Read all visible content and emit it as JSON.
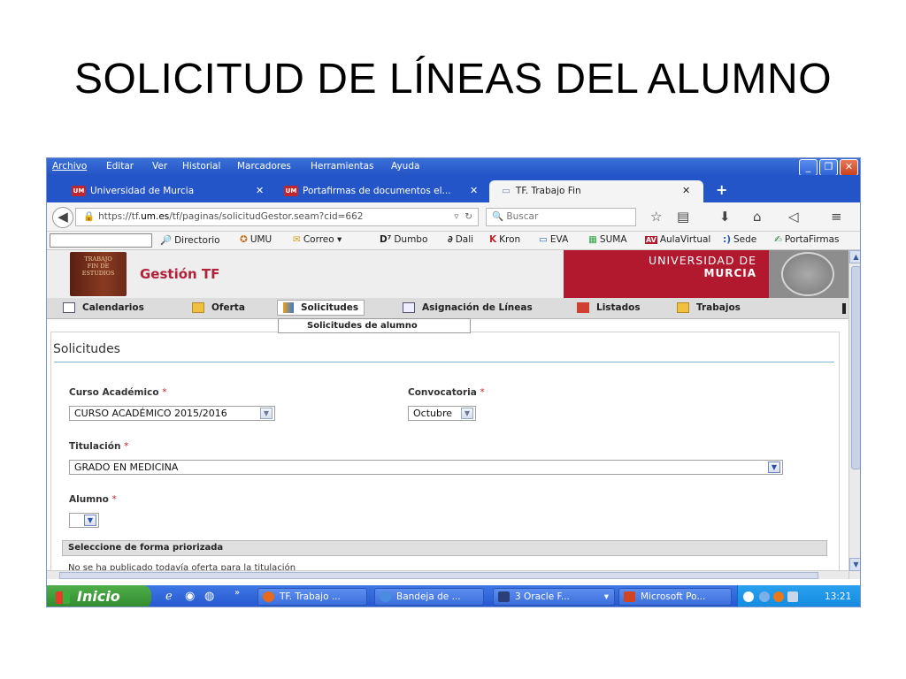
{
  "slide": {
    "title": "SOLICITUD DE LÍNEAS DEL ALUMNO"
  },
  "browser": {
    "menu": [
      "Archivo",
      "Editar",
      "Ver",
      "Historial",
      "Marcadores",
      "Herramientas",
      "Ayuda"
    ],
    "window_buttons": {
      "minimize": "_",
      "restore": "❐",
      "close": "✕"
    },
    "tabs": [
      {
        "label": "Universidad de Murcia",
        "favicon": "UM",
        "close": "✕"
      },
      {
        "label": "Portafirmas de documentos el...",
        "favicon": "UM",
        "close": "✕"
      },
      {
        "label": "TF. Trabajo Fin",
        "favicon": "doc-icon",
        "close": "✕"
      }
    ],
    "new_tab": "+",
    "url": {
      "prefix": "https://tf.",
      "domain": "um.es",
      "path": "/tf/paginas/solicitudGestor.seam?cid=662"
    },
    "search_placeholder": "Buscar",
    "bookmarks": [
      {
        "icon": "🔎",
        "label": "Directorio"
      },
      {
        "icon": "✪",
        "label": "UMU"
      },
      {
        "icon": "✉",
        "label": "Correo"
      },
      {
        "icon": "D⁷",
        "label": "Dumbo"
      },
      {
        "icon": "∂",
        "label": "Dali"
      },
      {
        "icon": "K",
        "label": "Kron"
      },
      {
        "icon": "▭",
        "label": "EVA"
      },
      {
        "icon": "▦",
        "label": "SUMA"
      },
      {
        "icon": "AV",
        "label": "AulaVirtual"
      },
      {
        "icon": ":)",
        "label": "Sede"
      },
      {
        "icon": "✍",
        "label": "PortaFirmas"
      }
    ]
  },
  "banner": {
    "book_text": "TRABAJO\nFIN DE\nESTUDIOS",
    "app_name": "Gestión TF",
    "univ_line1": "UNIVERSIDAD DE",
    "univ_line2": "MURCIA"
  },
  "app_nav": {
    "items": [
      "Calendarios",
      "Oferta",
      "Solicitudes",
      "Asignación de Líneas",
      "Listados",
      "Trabajos"
    ],
    "active": "Solicitudes",
    "dropdown_item": "Solicitudes de alumno"
  },
  "form": {
    "section_title": "Solicitudes",
    "curso_label": "Curso Académico",
    "curso_value": "CURSO ACADÉMICO 2015/2016",
    "convocatoria_label": "Convocatoria",
    "convocatoria_value": "Octubre",
    "titulacion_label": "Titulación",
    "titulacion_value": "GRADO EN MEDICINA",
    "alumno_label": "Alumno",
    "alumno_value": "",
    "required_mark": "*",
    "priority_header": "Seleccione de forma priorizada",
    "no_offer_message": "No se ha publicado todavía oferta para la titulación"
  },
  "taskbar": {
    "start_label": "Inicio",
    "more": "»",
    "tasks": [
      {
        "label": "TF. Trabajo ...",
        "color": "#e8681c"
      },
      {
        "label": "Bandeja de ...",
        "color": "#4a8de0"
      },
      {
        "label": "3 Oracle F...",
        "color": "#2a3f7a"
      },
      {
        "label": "Microsoft Po...",
        "color": "#d2431f"
      }
    ],
    "clock": "13:21"
  }
}
